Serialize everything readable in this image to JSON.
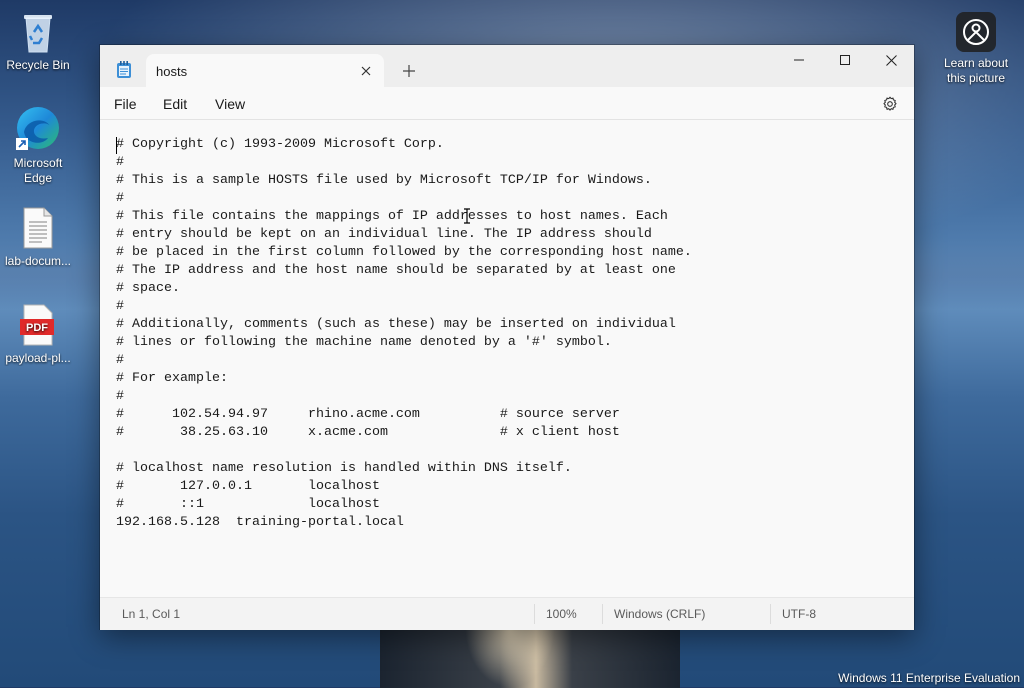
{
  "desktop": {
    "icons": [
      {
        "label": "Recycle Bin",
        "icon": "recycle-bin-icon"
      },
      {
        "label": "Microsoft Edge",
        "icon": "edge-icon"
      },
      {
        "label": "lab-docum...",
        "icon": "text-document-icon"
      },
      {
        "label": "payload-pl...",
        "icon": "pdf-file-icon"
      }
    ],
    "learn_about": "Learn about this picture",
    "watermark": "Windows 11 Enterprise Evaluation"
  },
  "window": {
    "tab_title": "hosts",
    "menu": [
      "File",
      "Edit",
      "View"
    ],
    "content": "# Copyright (c) 1993-2009 Microsoft Corp.\n#\n# This is a sample HOSTS file used by Microsoft TCP/IP for Windows.\n#\n# This file contains the mappings of IP addresses to host names. Each\n# entry should be kept on an individual line. The IP address should\n# be placed in the first column followed by the corresponding host name.\n# The IP address and the host name should be separated by at least one\n# space.\n#\n# Additionally, comments (such as these) may be inserted on individual\n# lines or following the machine name denoted by a '#' symbol.\n#\n# For example:\n#\n#      102.54.94.97     rhino.acme.com          # source server\n#       38.25.63.10     x.acme.com              # x client host\n\n# localhost name resolution is handled within DNS itself.\n#\t127.0.0.1       localhost\n#\t::1             localhost\n192.168.5.128  training-portal.local",
    "status": {
      "position": "Ln 1, Col 1",
      "zoom": "100%",
      "line_ending": "Windows (CRLF)",
      "encoding": "UTF-8"
    }
  }
}
